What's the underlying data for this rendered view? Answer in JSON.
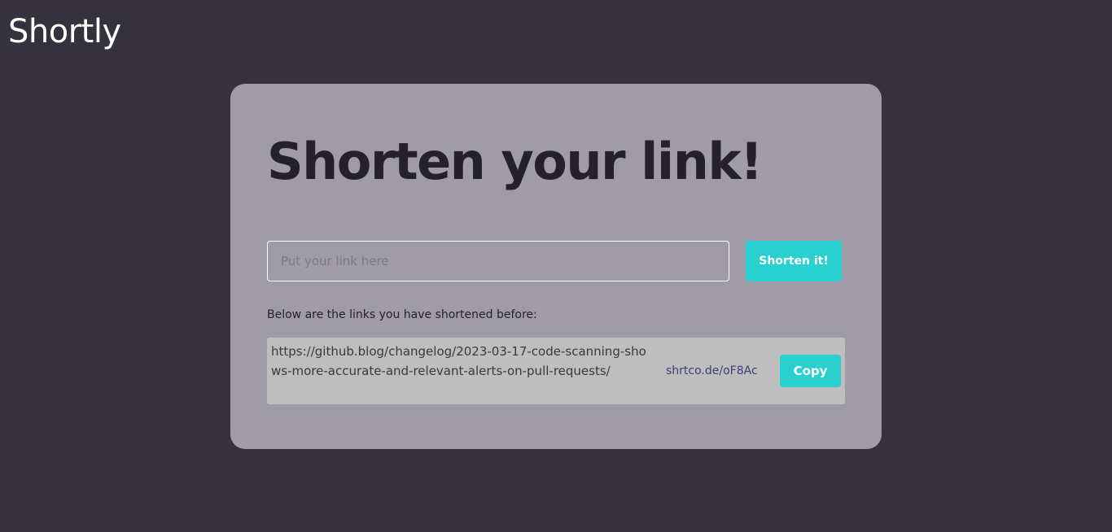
{
  "header": {
    "brand": "Shortly"
  },
  "card": {
    "headline": "Shorten your link!",
    "input": {
      "placeholder": "Put your link here",
      "value": ""
    },
    "shorten_button_label": "Shorten it!",
    "history_caption": "Below are the links you have shortened before:",
    "history": [
      {
        "original_url": "https://github.blog/changelog/2023-03-17-code-scanning-shows-more-accurate-and-relevant-alerts-on-pull-requests/",
        "short_url": "shrtco.de/oF8Ac",
        "copy_label": "Copy"
      }
    ]
  },
  "colors": {
    "page_background": "#35313d",
    "card_background": "#9f9ba7",
    "accent": "#2acfcf",
    "history_row_background": "#bebebe",
    "headline_text": "#24212a",
    "short_link_text": "#3b3f78"
  }
}
